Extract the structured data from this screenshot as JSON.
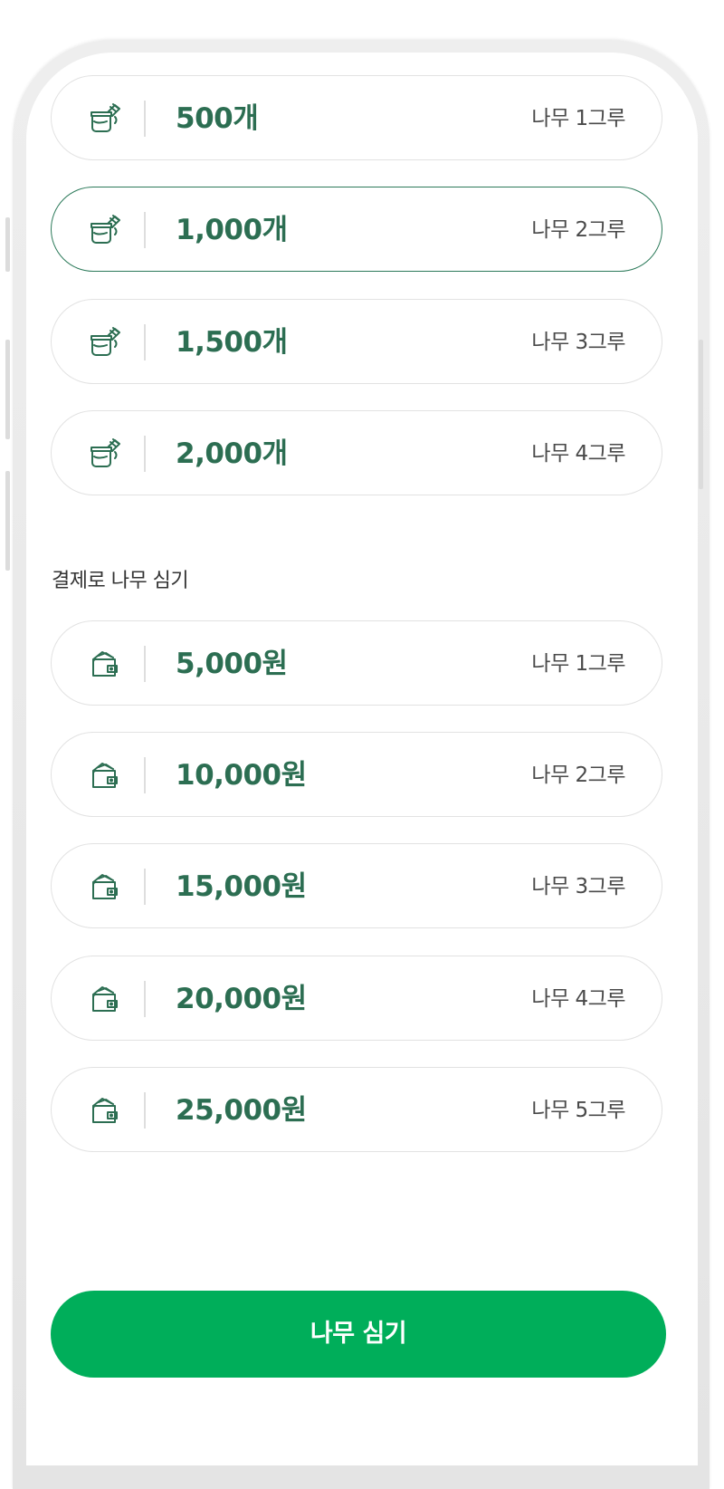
{
  "points_options": [
    {
      "amount": "500개",
      "trees": "나무 1그루",
      "selected": false,
      "icon": "coin-jar-icon"
    },
    {
      "amount": "1,000개",
      "trees": "나무 2그루",
      "selected": true,
      "icon": "coin-jar-icon"
    },
    {
      "amount": "1,500개",
      "trees": "나무 3그루",
      "selected": false,
      "icon": "coin-jar-icon"
    },
    {
      "amount": "2,000개",
      "trees": "나무 4그루",
      "selected": false,
      "icon": "coin-jar-icon"
    }
  ],
  "payment_section": {
    "label": "결제로 나무 심기"
  },
  "payment_options": [
    {
      "amount": "5,000원",
      "trees": "나무 1그루",
      "icon": "wallet-icon"
    },
    {
      "amount": "10,000원",
      "trees": "나무 2그루",
      "icon": "wallet-icon"
    },
    {
      "amount": "15,000원",
      "trees": "나무 3그루",
      "icon": "wallet-icon"
    },
    {
      "amount": "20,000원",
      "trees": "나무 4그루",
      "icon": "wallet-icon"
    },
    {
      "amount": "25,000원",
      "trees": "나무 5그루",
      "icon": "wallet-icon"
    }
  ],
  "cta": {
    "label": "나무 심기"
  },
  "colors": {
    "accent_green": "#00ae5a",
    "amount_text": "#2c6e52",
    "selected_border": "#2c7a5a",
    "card_border": "#e2e2e2"
  }
}
